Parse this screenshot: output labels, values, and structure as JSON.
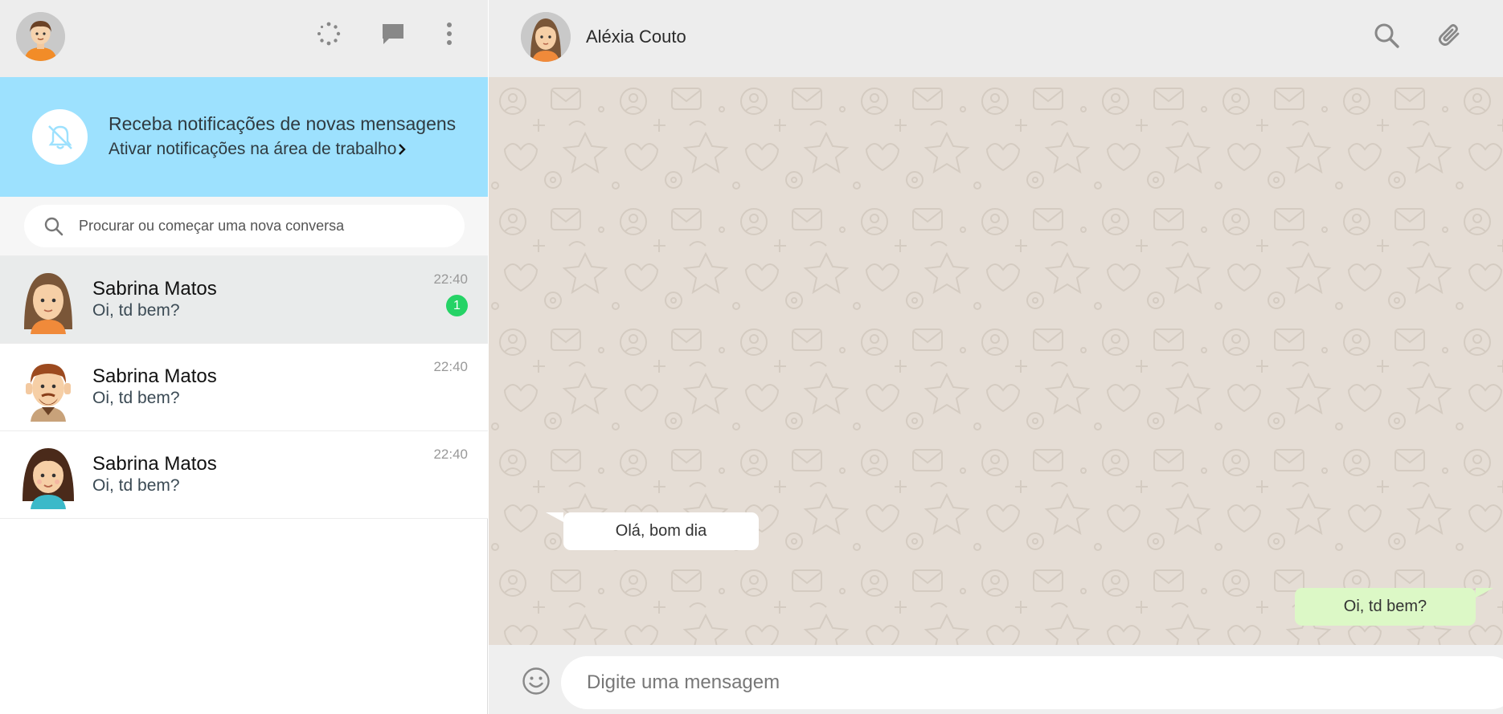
{
  "sidebar": {
    "header": {
      "my_avatar": "user-avatar-icon",
      "icons": [
        "status-icon",
        "new-chat-icon",
        "menu-icon"
      ]
    },
    "notification": {
      "icon": "bell-off-icon",
      "title": "Receba notificações de novas mensagens",
      "link": "Ativar notificações na área de trabalho",
      "link_icon": "chevron-right-icon"
    },
    "search": {
      "placeholder": "Procurar ou começar uma nova conversa",
      "icon": "search-icon"
    },
    "chats": [
      {
        "name": "Sabrina Matos",
        "last_message": "Oi, td bem?",
        "time": "22:40",
        "unread": "1",
        "active": true
      },
      {
        "name": "Sabrina Matos",
        "last_message": "Oi, td bem?",
        "time": "22:40"
      },
      {
        "name": "Sabrina Matos",
        "last_message": "Oi, td bem?",
        "time": "22:40"
      }
    ]
  },
  "conversation": {
    "contact_name": "Aléxia Couto",
    "header_icons": [
      "search-icon",
      "attach-icon"
    ],
    "messages": [
      {
        "direction": "in",
        "text": "Olá, bom dia"
      },
      {
        "direction": "out",
        "text": "Oi, td bem?"
      }
    ],
    "composer": {
      "placeholder": "Digite uma mensagem",
      "emoji_icon": "emoji-icon"
    }
  },
  "colors": {
    "notification_bg": "#9de1fe",
    "unread_badge": "#25d366",
    "chat_bg": "#e5ddd5",
    "outgoing_bubble": "#dcf8c6",
    "header_bg": "#ededed"
  }
}
